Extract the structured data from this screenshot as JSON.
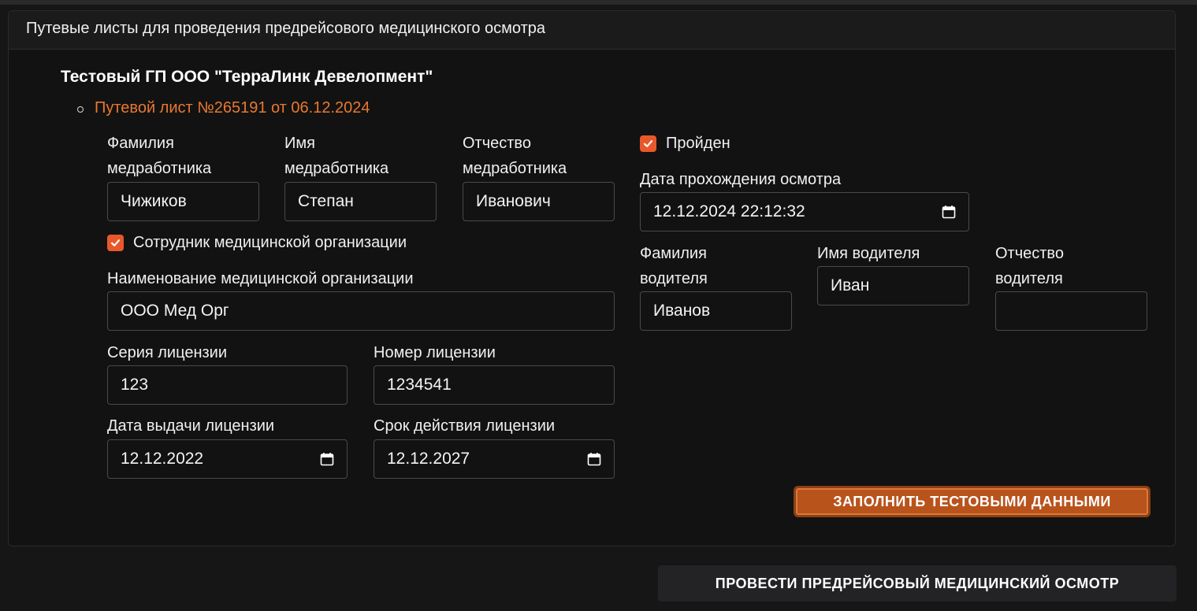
{
  "panel": {
    "title": "Путевые листы для проведения предрейсового медицинского осмотра"
  },
  "organization": {
    "name": "Тестовый ГП ООО \"ТерраЛинк Девелопмент\""
  },
  "waybill": {
    "link_label": "Путевой лист №265191 от 06.12.2024"
  },
  "medic": {
    "last_name_label_line1": "Фамилия",
    "last_name_label_line2": "медработника",
    "last_name_value": "Чижиков",
    "first_name_label_line1": "Имя",
    "first_name_label_line2": "медработника",
    "first_name_value": "Степан",
    "patronymic_label_line1": "Отчество",
    "patronymic_label_line2": "медработника",
    "patronymic_value": "Иванович",
    "is_employee_label": "Сотрудник медицинской организации",
    "is_employee_checked": true,
    "org_name_label": "Наименование медицинской организации",
    "org_name_value": "ООО Мед Орг",
    "license_series_label": "Серия лицензии",
    "license_series_value": "123",
    "license_number_label": "Номер лицензии",
    "license_number_value": "1234541",
    "license_issue_label": "Дата выдачи лицензии",
    "license_issue_value": "12.12.2022",
    "license_expiry_label": "Срок действия лицензии",
    "license_expiry_value": "12.12.2027"
  },
  "exam": {
    "passed_label": "Пройден",
    "passed_checked": true,
    "date_label": "Дата прохождения осмотра",
    "date_value": "12.12.2024 22:12:32"
  },
  "driver": {
    "last_name_label_line1": "Фамилия",
    "last_name_label_line2": "водителя",
    "last_name_value": "Иванов",
    "first_name_label": "Имя водителя",
    "first_name_value": "Иван",
    "patronymic_label_line1": "Отчество",
    "patronymic_label_line2": "водителя",
    "patronymic_value": ""
  },
  "buttons": {
    "fill_test_data": "ЗАПОЛНИТЬ ТЕСТОВЫМИ ДАННЫМИ",
    "conduct_exam": "ПРОВЕСТИ ПРЕДРЕЙСОВЫЙ МЕДИЦИНСКИЙ ОСМОТР"
  },
  "colors": {
    "accent": "#e8782f",
    "checkbox": "#e8582a",
    "button_orange": "#b9531c"
  },
  "icons": {
    "calendar": "calendar-icon",
    "check": "check-icon"
  }
}
